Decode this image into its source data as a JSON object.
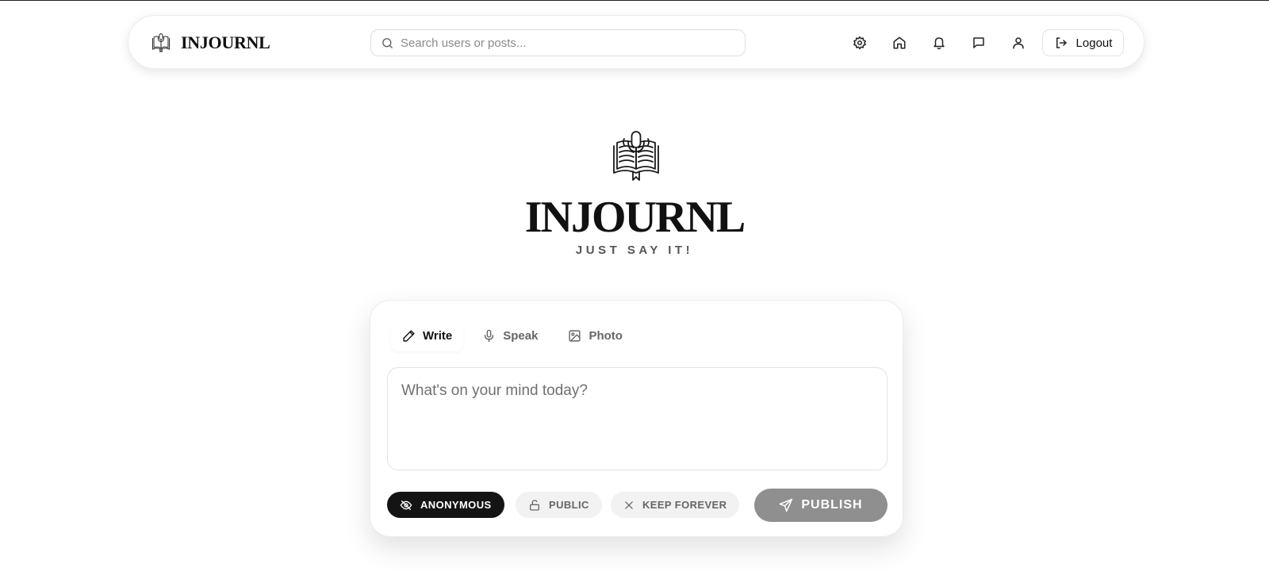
{
  "header": {
    "brand_name": "INJOURNL",
    "search_placeholder": "Search users or posts...",
    "nav_icons": [
      "gear-icon",
      "home-icon",
      "bell-icon",
      "message-icon",
      "user-icon"
    ],
    "logout_label": "Logout"
  },
  "hero": {
    "title": "INJOURNL",
    "tagline": "JUST SAY IT!"
  },
  "composer": {
    "tabs": [
      {
        "label": "Write",
        "icon": "pencil-icon",
        "active": true
      },
      {
        "label": "Speak",
        "icon": "microphone-icon",
        "active": false
      },
      {
        "label": "Photo",
        "icon": "image-icon",
        "active": false
      }
    ],
    "text_placeholder": "What's on your mind today?",
    "options": {
      "anonymous_label": "ANONYMOUS",
      "public_label": "PUBLIC",
      "keep_label": "KEEP FOREVER"
    },
    "publish_label": "PUBLISH"
  },
  "colors": {
    "accent_dark": "#141414",
    "publish_disabled": "#8f8f8f",
    "pill_bg": "#f2f2f2"
  }
}
